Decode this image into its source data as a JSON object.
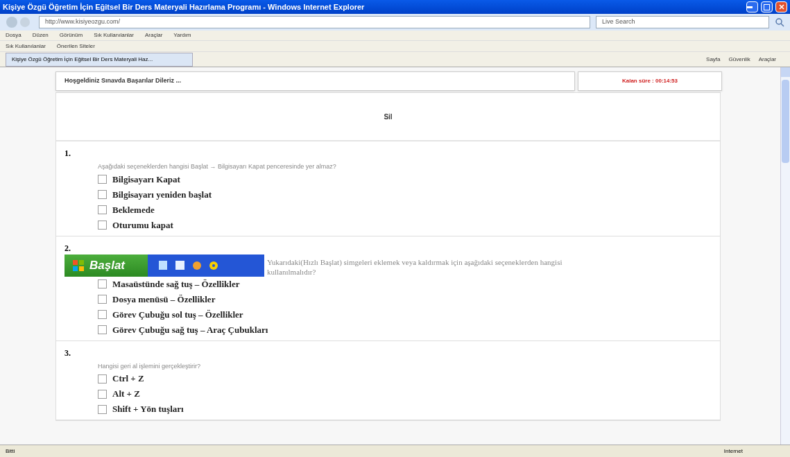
{
  "window": {
    "title": "Kişiye Özgü Öğretim İçin Eğitsel Bir Ders Materyali Hazırlama Programı - Windows Internet Explorer"
  },
  "address_bar": {
    "url": "http://www.kisiyeozgu.com/",
    "search_placeholder": "Live Search"
  },
  "menu": [
    "Dosya",
    "Düzen",
    "Görünüm",
    "Sık Kullanılanlar",
    "Araçlar",
    "Yardım"
  ],
  "favorites_bar": [
    "Sık Kullanılanlar",
    "Önerilen Siteler"
  ],
  "tab": {
    "label": "Kişiye Özgü Öğretim İçin Eğitsel Bir Ders Materyali Haz...",
    "selected": true
  },
  "command_bar": [
    "Sayfa",
    "Güvenlik",
    "Araçlar"
  ],
  "page": {
    "welcome": "Hoşgeldiniz Sınavda Başarılar Dileriz ...",
    "timer": "Kalan süre : 00:14:53",
    "heading": "Sil",
    "questions": [
      {
        "number": "1.",
        "text": "Aşağıdaki seçeneklerden hangisi Başlat → Bilgisayarı Kapat penceresinde yer almaz?",
        "options": [
          {
            "label": "Bilgisayarı Kapat",
            "checked": false
          },
          {
            "label": "Bilgisayarı yeniden başlat",
            "checked": false
          },
          {
            "label": "Beklemede",
            "checked": false
          },
          {
            "label": "Oturumu kapat",
            "checked": false
          }
        ]
      },
      {
        "number": "2.",
        "image_text": "Başlat",
        "text": "Yukarıdaki(Hızlı Başlat) simgeleri eklemek veya kaldırmak için aşağıdaki seçeneklerden hangisi kullanılmalıdır?",
        "options": [
          {
            "label": "Masaüstünde sağ tuş – Özellikler",
            "checked": false
          },
          {
            "label": "Dosya menüsü – Özellikler",
            "checked": false
          },
          {
            "label": "Görev Çubuğu sol tuş – Özellikler",
            "checked": false
          },
          {
            "label": "Görev Çubuğu sağ tuş – Araç Çubukları",
            "checked": false
          }
        ]
      },
      {
        "number": "3.",
        "text": "Hangisi geri al işlemini gerçekleştirir?",
        "options": [
          {
            "label": "Ctrl + Z",
            "checked": false
          },
          {
            "label": "Alt + Z",
            "checked": false
          },
          {
            "label": "Shift + Yön tuşları",
            "checked": false
          }
        ]
      }
    ]
  },
  "status_bar": {
    "text": "Bitti",
    "zone": "Internet"
  }
}
